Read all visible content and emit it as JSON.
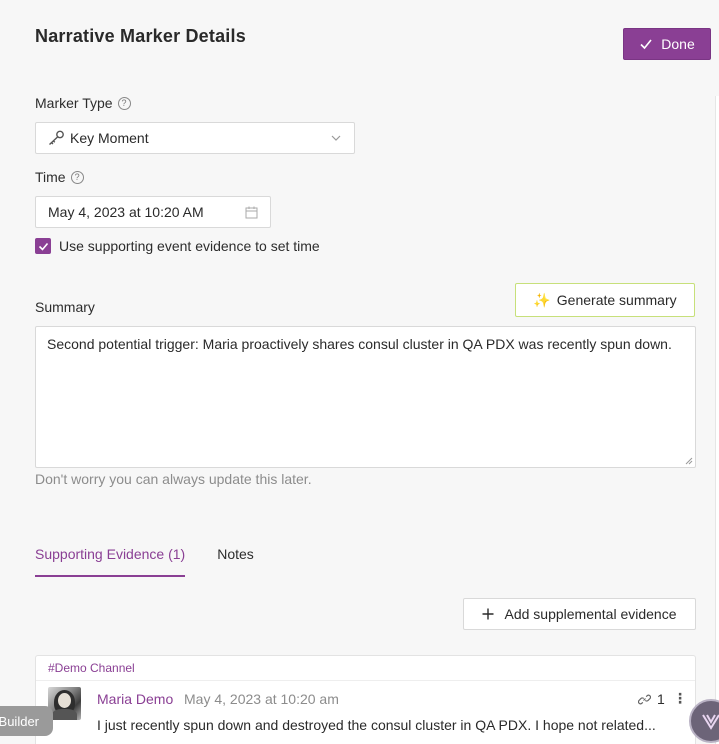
{
  "title": "Narrative Marker Details",
  "done_label": "Done",
  "marker_type": {
    "label": "Marker Type",
    "value": "Key Moment"
  },
  "time": {
    "label": "Time",
    "value": "May 4, 2023 at 10:20 AM"
  },
  "use_evidence": {
    "label": "Use supporting event evidence to set time",
    "checked": true
  },
  "summary": {
    "label": "Summary",
    "generate_label": "Generate summary",
    "text": "Second potential trigger:  Maria proactively shares consul cluster in QA PDX was recently spun down.",
    "hint": "Don't worry you can always update this later."
  },
  "tabs": [
    {
      "label": "Supporting Evidence (1)",
      "active": true
    },
    {
      "label": "Notes",
      "active": false
    }
  ],
  "add_evidence_label": "Add supplemental evidence",
  "evidence": {
    "channel": "#Demo Channel",
    "author": "Maria Demo",
    "timestamp": "May 4, 2023 at 10:20 am",
    "link_count": "1",
    "message": "I  just recently spun down and destroyed the consul cluster in QA PDX. I hope not related..."
  },
  "builder_label": "Builder",
  "colors": {
    "accent": "#8a3f94",
    "generate_border": "#c7e07a"
  }
}
